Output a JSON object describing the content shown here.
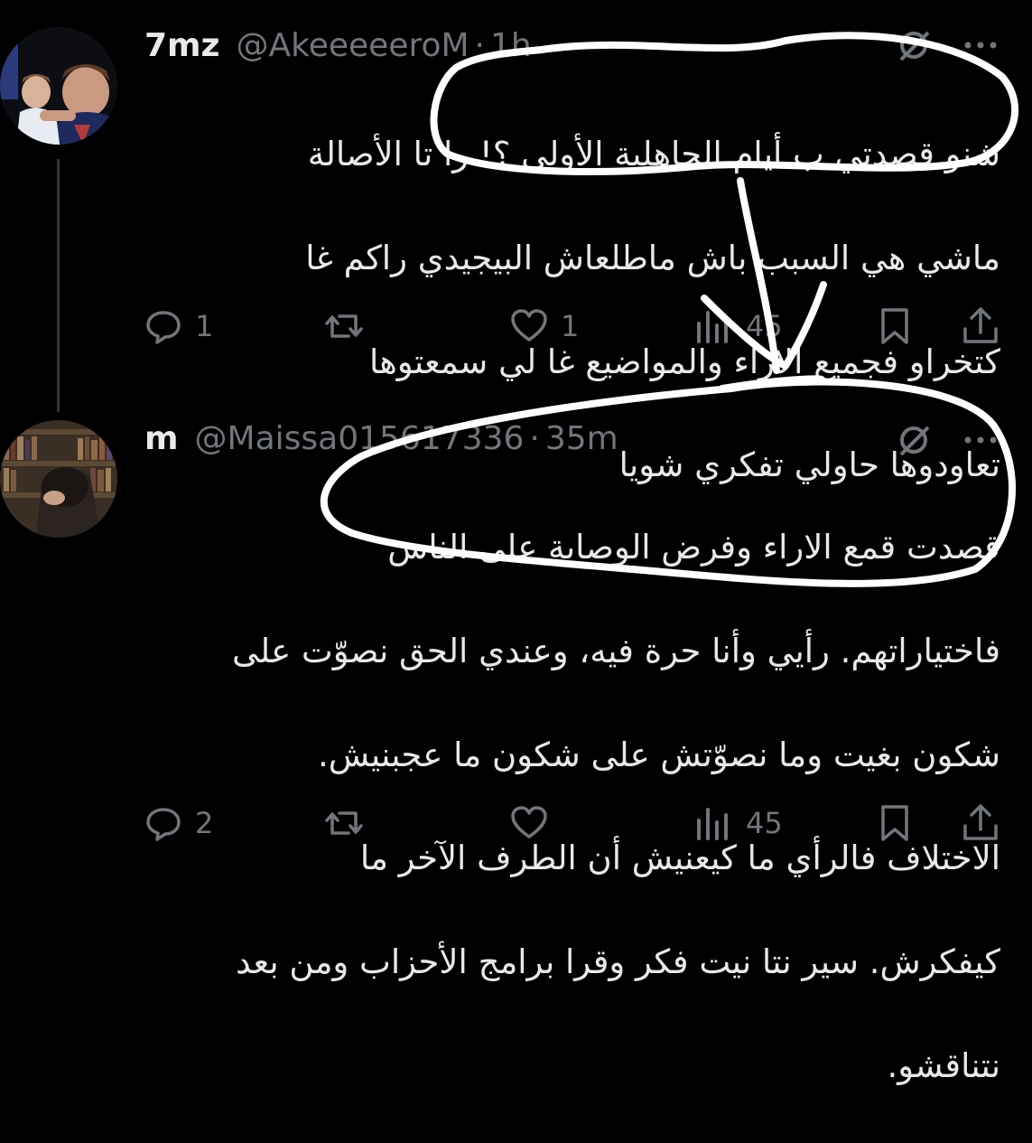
{
  "tweets": [
    {
      "name": "7mz",
      "handle": "@AkeeeeeroM",
      "time": "1h",
      "lines": [
        "شنو قصدتي ب أيام الجاهلية الأولى ؟! را تا الأصالة",
        "ماشي هي السبب باش ماطلعاش البيجيدي راكم غا",
        "كتخراو فجميع الاراء والمواضيع غا لي سمعتوها",
        "تعاودوها حاولي تفكري شويا"
      ],
      "replies": "1",
      "reposts": "",
      "likes": "1",
      "views": "45"
    },
    {
      "name": "m",
      "handle": "@Maissa015617336",
      "time": "35m",
      "lines": [
        "قصدت قمع الاراء وفرض الوصاية على الناس",
        "فاختياراتهم. رأيي وأنا حرة فيه، وعندي الحق نصوّت على",
        "شكون بغيت وما نصوّتش على شكون ما عجبنيش.",
        "الاختلاف فالرأي ما كيعنيش أن الطرف الآخر ما",
        "كيفكرش. سير نتا نيت فكر وقرا برامج الأحزاب ومن بعد",
        "نتناقشو."
      ],
      "replies": "2",
      "reposts": "",
      "likes": "",
      "views": "45"
    }
  ],
  "icons": {
    "reply": "reply-icon",
    "repost": "repost-icon",
    "like": "heart-icon",
    "views": "views-icon",
    "bookmark": "bookmark-icon",
    "share": "share-icon",
    "grok": "grok-icon",
    "more": "more-icon"
  },
  "colors": {
    "background": "#000000",
    "text": "#e7e9ea",
    "muted": "#71767b",
    "annotation": "#ffffff"
  }
}
